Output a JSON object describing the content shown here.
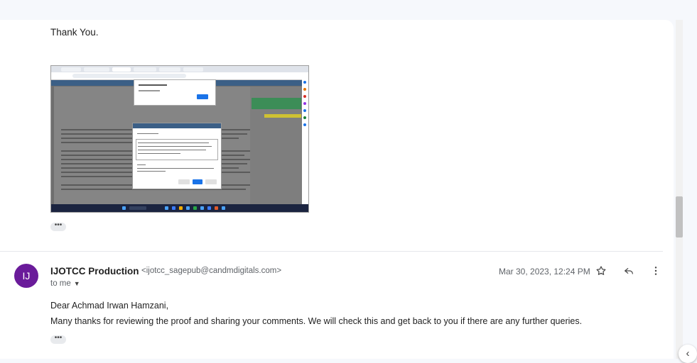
{
  "previous_message": {
    "closing": "Thank You."
  },
  "attachment": {
    "icon": "screenshot-image"
  },
  "show_trimmed": "•••",
  "message": {
    "avatar_initials": "IJ",
    "avatar_color": "#6a1b9a",
    "sender_name": "IJOTCC Production",
    "sender_email": "<ijotcc_sagepub@candmdigitals.com>",
    "recipient": "to me",
    "date": "Mar 30, 2023, 12:24 PM",
    "greeting": "Dear Achmad Irwan Hamzani,",
    "body": "Many thanks for reviewing the proof and sharing your comments. We will check this and get back to you if there are any further queries."
  },
  "icons": {
    "star": "star-icon",
    "reply": "reply-icon",
    "more": "more-vert-icon",
    "collapse": "chevron-left-icon"
  }
}
